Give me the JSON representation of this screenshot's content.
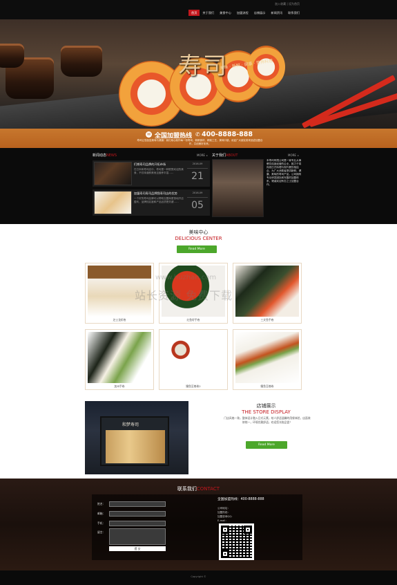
{
  "header": {
    "top_links": "加入收藏 | 设为首页",
    "nav": [
      {
        "label": "首页",
        "active": true
      },
      {
        "label": "关于我们",
        "active": false
      },
      {
        "label": "美食中心",
        "active": false
      },
      {
        "label": "加盟流程",
        "active": false
      },
      {
        "label": "店铺展示",
        "active": false
      },
      {
        "label": "新闻资讯",
        "active": false
      },
      {
        "label": "联系我们",
        "active": false
      }
    ]
  },
  "hero": {
    "title": "寿司",
    "slogan": "美味 · 新鲜 · 健康 · 营养料理",
    "hotline_label": "全国加盟热线",
    "hotline_number": "400-8888-888",
    "hotline_desc": "寿司让您品尝美味与健康！我们用心制作每一份寿司，新鲜食材、精致工艺、美味口感，欢迎广大朋友前来品尝加盟合作，共创美好未来。"
  },
  "news": {
    "title_cn": "新闻动态",
    "title_en": "NEWS",
    "more": "MORE",
    "items": [
      {
        "title": "们期寿司品牌的开拓市场",
        "summary": "在日本和寿司店中，寿司是一种很受欢迎的美食，不仅味道鲜美而且营养丰富……",
        "ym": "2016-09",
        "day": "21"
      },
      {
        "title": "加盟寿司寿司品牌我寿司店的优势",
        "summary": "一个好的寿司品牌可以帮助加盟商更快地开店盈利，品牌知名度和产品品质是关键……",
        "ym": "2016-09",
        "day": "05"
      }
    ]
  },
  "about": {
    "title_cn": "关于我们",
    "title_en": "ABOUT",
    "more": "MORE",
    "text": "本寿司有限公司是一家专业从事餐饮连锁经营的企业，致力于将传统日式料理与现代餐饮相结合，为广大消费者提供新鲜、健康、美味的寿司产品。公司拥有专业研发团队和完善的加盟体系，竭诚欢迎有志之士加盟合作。"
  },
  "delicious": {
    "title_cn": "美味中心",
    "title_en": "DELICIOUS CENTER",
    "button": "Read More",
    "products": [
      {
        "name": "芝士龙虾卷"
      },
      {
        "name": "红鱼籽手卷"
      },
      {
        "name": "三文鱼手卷"
      },
      {
        "name": "加州手卷"
      },
      {
        "name": "鳗鱼至尊卷2"
      },
      {
        "name": "鳗鱼至尊卷"
      }
    ]
  },
  "store": {
    "title_cn": "店铺展示",
    "title_en": "THE STORE DISPLAY",
    "sign": "和梦寿司",
    "description": "门店风格一致，整体设计融入日式元素，给人舒适温馨的用餐体验，店面装修统一，环境优雅舒适，欢迎您光临品尝！",
    "button": "Read More"
  },
  "watermark": {
    "url": "www.huzhan.com",
    "text": "站长资源 免费下载"
  },
  "contact": {
    "title_cn": "联系我们",
    "title_en": "CONTACT",
    "form": {
      "name_label": "姓名：",
      "email_label": "邮箱：",
      "phone_label": "手机：",
      "message_label": "留言：",
      "submit": "提 交"
    },
    "hotline_label": "全国加盟热线：",
    "hotline_number": "400-8888-888",
    "company": "公司地址：",
    "join_phone": "加盟热线：",
    "join_qq": "加盟咨询QQ：",
    "email": "E-mail："
  },
  "footer": {
    "copyright": "Copyright ©"
  }
}
